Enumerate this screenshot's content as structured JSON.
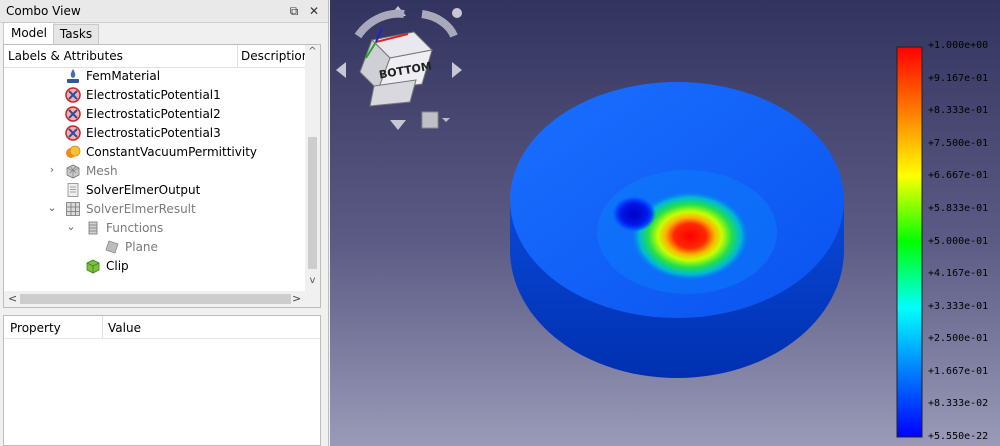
{
  "combo_view": {
    "title": "Combo View",
    "float_glyph": "⧉",
    "close_glyph": "✕"
  },
  "tabs": [
    {
      "label": "Model",
      "active": true
    },
    {
      "label": "Tasks",
      "active": false
    }
  ],
  "tree": {
    "col_labels": "Labels & Attributes",
    "col_description": "Description",
    "items": [
      {
        "label": "FemMaterial",
        "icon": "fem-material-icon",
        "greyed": false
      },
      {
        "label": "ElectrostaticPotential1",
        "icon": "constraint-icon",
        "greyed": false
      },
      {
        "label": "ElectrostaticPotential2",
        "icon": "constraint-icon",
        "greyed": false
      },
      {
        "label": "ElectrostaticPotential3",
        "icon": "constraint-icon",
        "greyed": false
      },
      {
        "label": "ConstantVacuumPermittivity",
        "icon": "constant-icon",
        "greyed": false
      },
      {
        "label": "Mesh",
        "icon": "mesh-icon",
        "greyed": true,
        "expander": "›"
      },
      {
        "label": "SolverElmerOutput",
        "icon": "document-icon",
        "greyed": false
      },
      {
        "label": "SolverElmerResult",
        "icon": "result-grid-icon",
        "greyed": true,
        "expander": "⌄"
      },
      {
        "label": "Functions",
        "icon": "functions-icon",
        "greyed": true,
        "expander": "⌄"
      },
      {
        "label": "Plane",
        "icon": "plane-icon",
        "greyed": true
      },
      {
        "label": "Clip",
        "icon": "clip-icon",
        "greyed": false
      }
    ],
    "scroll_left": "<",
    "scroll_right": ">",
    "scroll_up": "^",
    "scroll_down": "v"
  },
  "properties": {
    "col_property": "Property",
    "col_value": "Value"
  },
  "navcube": {
    "face_label": "BOTTOM"
  },
  "legend": {
    "labels": [
      "+1.000e+00",
      "+9.167e-01",
      "+8.333e-01",
      "+7.500e-01",
      "+6.667e-01",
      "+5.833e-01",
      "+5.000e-01",
      "+4.167e-01",
      "+3.333e-01",
      "+2.500e-01",
      "+1.667e-01",
      "+8.333e-02",
      "+5.550e-22"
    ],
    "colors": {
      "max": "#ff0000",
      "mid": "#00ff00",
      "min": "#0000ff"
    }
  }
}
